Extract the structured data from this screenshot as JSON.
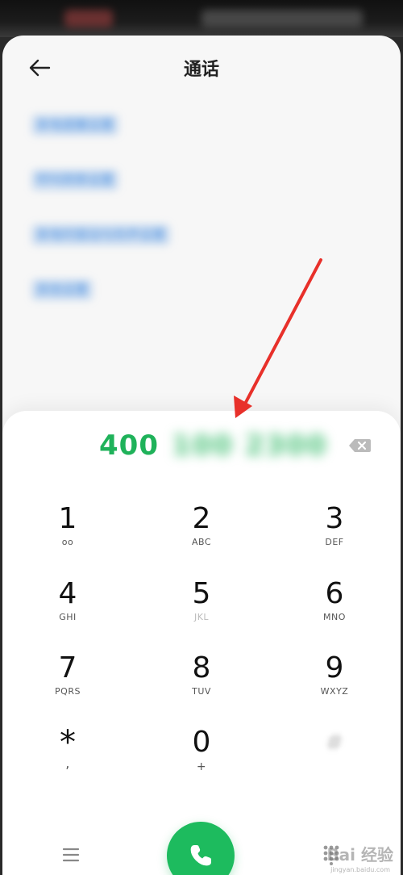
{
  "header": {
    "title": "通话"
  },
  "settings_list": [
    {
      "label": "来电提醒设置"
    },
    {
      "label": "呼叫转移设置"
    },
    {
      "label": "来电时振动与铃声设置"
    },
    {
      "label": "其他设置"
    }
  ],
  "dialer": {
    "number_prefix": "400",
    "number_hidden": "100 2300",
    "keys": [
      {
        "digit": "1",
        "letters": "ᴏᴏ"
      },
      {
        "digit": "2",
        "letters": "ABC"
      },
      {
        "digit": "3",
        "letters": "DEF"
      },
      {
        "digit": "4",
        "letters": "GHI"
      },
      {
        "digit": "5",
        "letters": "JKL"
      },
      {
        "digit": "6",
        "letters": "MNO"
      },
      {
        "digit": "7",
        "letters": "PQRS"
      },
      {
        "digit": "8",
        "letters": "TUV"
      },
      {
        "digit": "9",
        "letters": "WXYZ"
      },
      {
        "digit": "*",
        "letters": ","
      },
      {
        "digit": "0",
        "letters": "+"
      },
      {
        "digit": "#",
        "letters": ""
      }
    ]
  },
  "watermark": {
    "text": "Bai 经验",
    "sub": "jingyan.baidu.com"
  },
  "colors": {
    "accent_green": "#1dbb5e",
    "number_green": "#1fb25a",
    "link_blue": "#4a8fe0",
    "annotation_red": "#e8302a"
  },
  "icons": [
    "back-arrow-icon",
    "delete-icon",
    "menu-icon",
    "phone-icon",
    "keypad-icon"
  ]
}
